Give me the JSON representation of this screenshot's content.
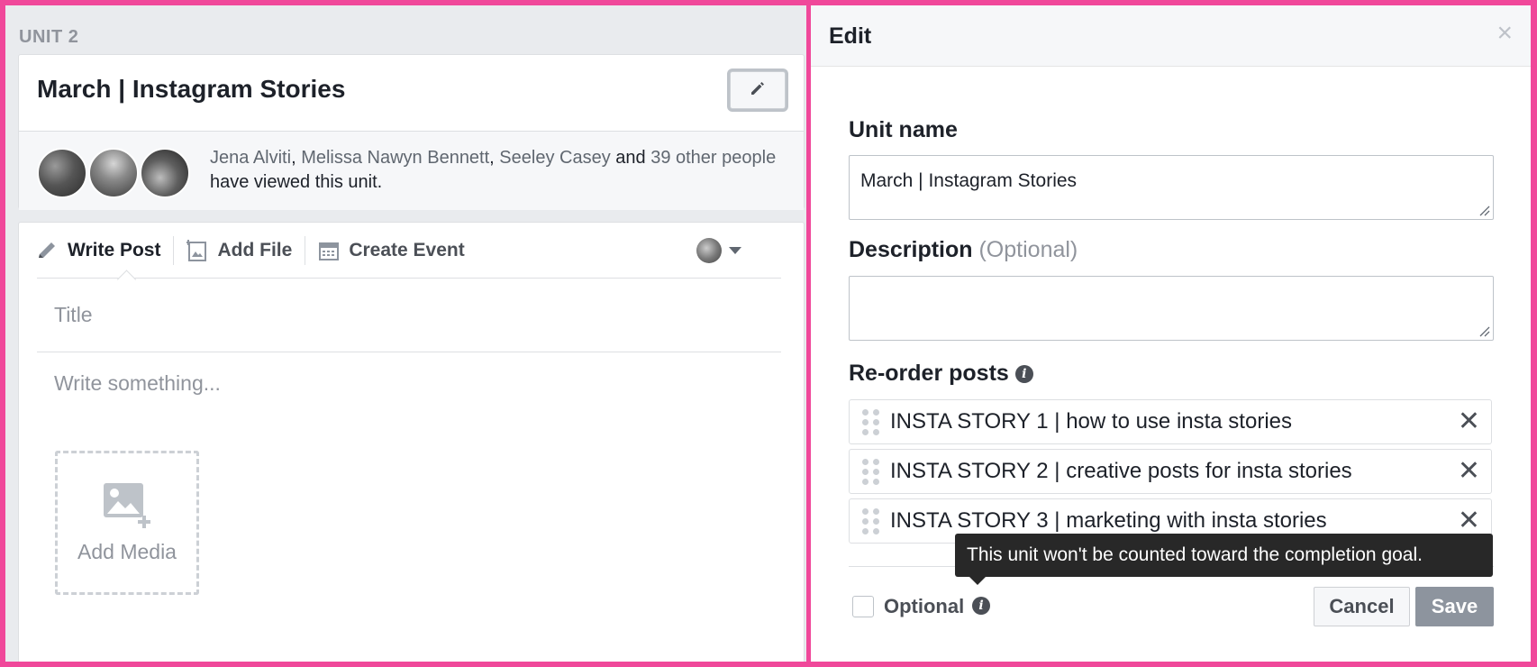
{
  "left": {
    "unit_label": "UNIT 2",
    "unit_title": "March | Instagram Stories",
    "viewers": {
      "name1": "Jena Alviti",
      "name2": "Melissa Nawyn Bennett",
      "name3": "Seeley Casey",
      "and_text": "and",
      "others": "39 other people",
      "suffix": "have viewed this unit."
    },
    "composer": {
      "tabs": [
        {
          "label": "Write Post",
          "icon": "pencil-icon"
        },
        {
          "label": "Add File",
          "icon": "file-icon"
        },
        {
          "label": "Create Event",
          "icon": "calendar-icon"
        }
      ],
      "title_placeholder": "Title",
      "body_placeholder": "Write something...",
      "add_media_label": "Add Media"
    }
  },
  "modal": {
    "title": "Edit",
    "close_icon": "close-icon",
    "unit_name_label": "Unit name",
    "unit_name_value": "March | Instagram Stories",
    "description_label": "Description",
    "description_optional": "(Optional)",
    "description_value": "",
    "reorder_label": "Re-order posts",
    "posts": [
      "INSTA STORY 1 | how to use insta stories",
      "INSTA STORY 2 | creative posts for insta stories",
      "INSTA STORY 3 | marketing with insta stories"
    ],
    "tooltip": "This unit won't be counted toward the completion goal.",
    "optional_label": "Optional",
    "optional_checked": false,
    "cancel_label": "Cancel",
    "save_label": "Save"
  },
  "colors": {
    "frame_pink": "#f0489a",
    "save_button": "#8d949e",
    "tooltip_bg": "#282828"
  }
}
